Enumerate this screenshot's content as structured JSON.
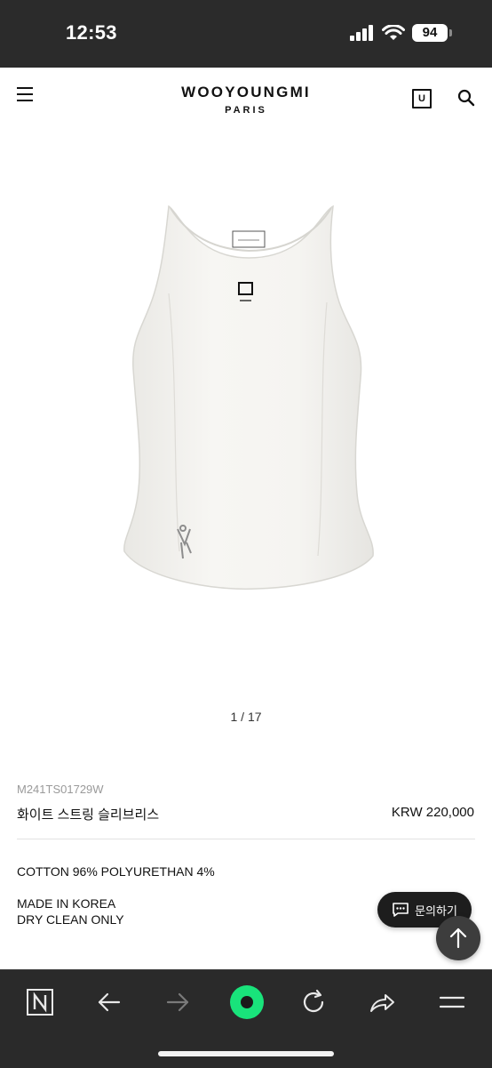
{
  "status_bar": {
    "time": "12:53",
    "battery": "94",
    "icons": [
      "signal-icon",
      "wifi-icon",
      "battery-icon"
    ]
  },
  "header": {
    "brand_name": "WOOYOUNGMI",
    "brand_sub": "PARIS",
    "bag_letter": "U",
    "icons": [
      "menu-icon",
      "bag-icon",
      "search-icon"
    ]
  },
  "product": {
    "pager": "1 / 17",
    "sku": "M241TS01729W",
    "name": "화이트 스트링 슬리브리스",
    "price": "KRW 220,000",
    "composition": "COTTON 96% POLYURETHAN 4%",
    "origin": "MADE IN KOREA",
    "care": "DRY CLEAN ONLY"
  },
  "floating": {
    "inquiry_label": "문의하기",
    "icons": [
      "chat-icon",
      "arrow-up-icon"
    ]
  },
  "browser_bar": {
    "icons": [
      "naver-n-icon",
      "back-arrow-icon",
      "forward-arrow-icon",
      "green-dot-icon",
      "reload-icon",
      "share-icon",
      "menu-lines-icon"
    ]
  },
  "colors": {
    "status_bg": "#2b2b2b",
    "browser_bg": "#2a2a2a",
    "accent_green": "#19e37b",
    "text": "#111111",
    "sku_grey": "#9a9a9a"
  }
}
